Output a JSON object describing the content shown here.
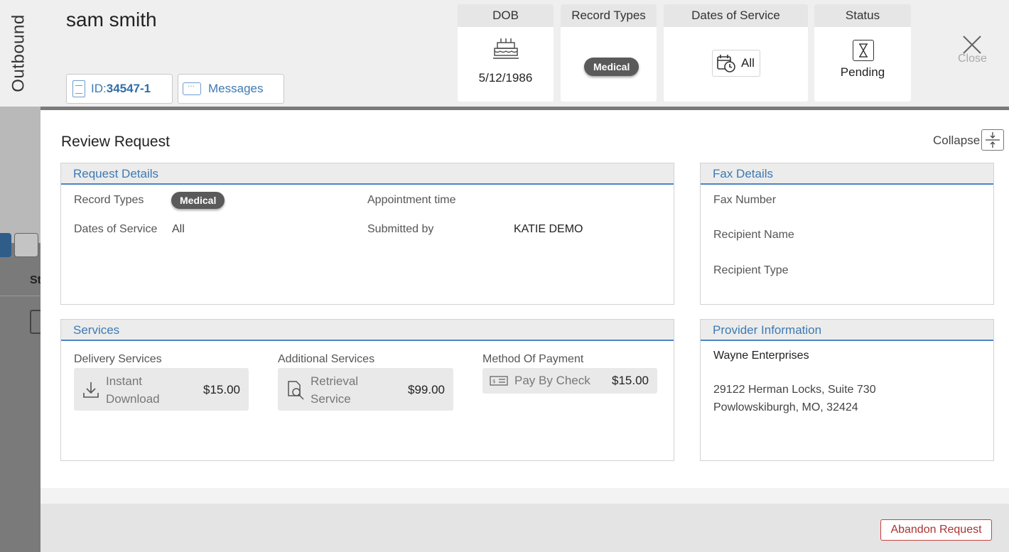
{
  "side_label": "Outbound",
  "patient": {
    "name": "sam smith",
    "id_label": "ID:",
    "id_value": "34547-1",
    "messages_label": "Messages"
  },
  "summary": {
    "dob_header": "DOB",
    "dob_value": "5/12/1986",
    "record_types_header": "Record Types",
    "record_types_value": "Medical",
    "dates_header": "Dates of Service",
    "dates_value": "All",
    "status_header": "Status",
    "status_value": "Pending",
    "close_label": "Close"
  },
  "review": {
    "title": "Review Request",
    "collapse_label": "Collapse"
  },
  "request_details": {
    "title": "Request Details",
    "record_types_label": "Record Types",
    "record_types_value": "Medical",
    "dates_label": "Dates of Service",
    "dates_value": "All",
    "appointment_label": "Appointment time",
    "submitted_label": "Submitted by",
    "submitted_value": "KATIE DEMO"
  },
  "fax_details": {
    "title": "Fax Details",
    "fax_number_label": "Fax Number",
    "recipient_name_label": "Recipient Name",
    "recipient_type_label": "Recipient Type"
  },
  "services": {
    "title": "Services",
    "delivery_label": "Delivery Services",
    "delivery_line1": "Instant",
    "delivery_line2": "Download",
    "delivery_price": "$15.00",
    "additional_label": "Additional Services",
    "additional_line1": "Retrieval",
    "additional_line2": "Service",
    "additional_price": "$99.00",
    "payment_label": "Method Of Payment",
    "payment_name": "Pay By Check",
    "payment_price": "$15.00"
  },
  "provider": {
    "title": "Provider Information",
    "name": "Wayne Enterprises",
    "address_line1": "29122 Herman Locks, Suite 730",
    "address_line2": "Powlowskiburgh, MO, 32424"
  },
  "footer": {
    "abandon_label": "Abandon Request"
  },
  "colors": {
    "accent": "#3d7ab3",
    "pill": "#5a5a5a",
    "danger": "#c94242"
  }
}
